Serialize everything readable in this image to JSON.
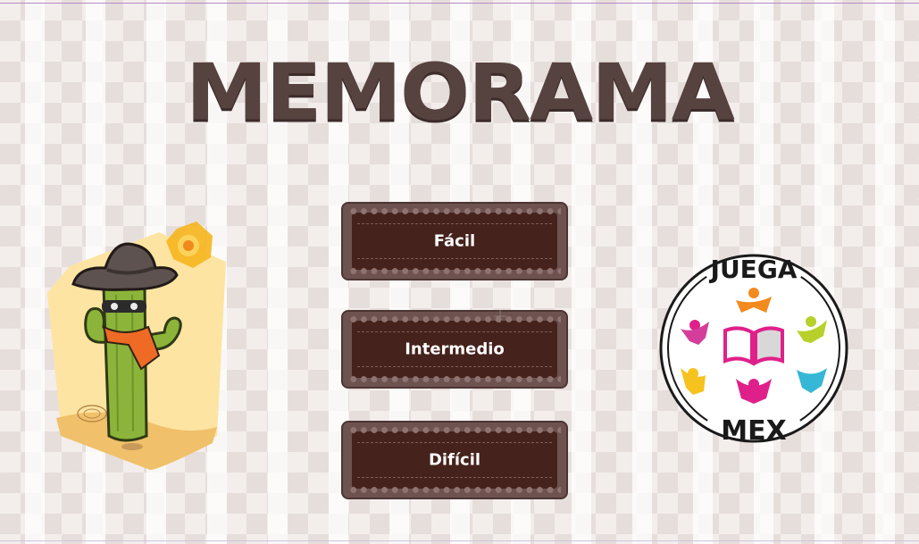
{
  "title": "MEMORAMA",
  "menu": {
    "easy": "Fácil",
    "medium": "Intermedio",
    "hard": "Difícil"
  },
  "logo": {
    "top_text": "JUEGA",
    "bottom_text": "MEX"
  },
  "colors": {
    "title": "#56423f",
    "button_outer": "#6e5250",
    "button_inner": "#45221b",
    "button_text": "#ffffff",
    "cactus_green": "#8cb43a",
    "hat": "#5d524f",
    "bandana": "#ef6a24",
    "sun": "#f6b51d"
  }
}
